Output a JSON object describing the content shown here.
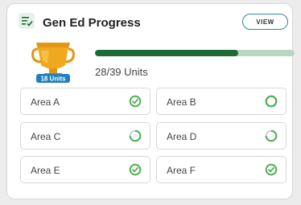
{
  "card": {
    "title": "Gen Ed Progress",
    "view_label": "VIEW",
    "badge_label": "18 Units",
    "units_text": "28/39 Units",
    "progress": {
      "completed": 28,
      "total": 39
    }
  },
  "areas": [
    {
      "label": "Area A",
      "status": "complete"
    },
    {
      "label": "Area B",
      "status": "not-started"
    },
    {
      "label": "Area C",
      "status": "in-progress"
    },
    {
      "label": "Area D",
      "status": "in-progress"
    },
    {
      "label": "Area E",
      "status": "complete"
    },
    {
      "label": "Area F",
      "status": "complete"
    }
  ],
  "colors": {
    "accent_green": "#1d6a37",
    "status_green": "#4caf50",
    "track": "#b9d6c4",
    "button_border": "#2b8a9e",
    "trophy_gold": "#f0a81e",
    "badge_blue": "#1f7fc0"
  },
  "icons": {
    "header": "checklist-icon",
    "trophy": "trophy-icon",
    "complete": "check-circle-icon",
    "in_progress": "partial-circle-icon",
    "not_started": "open-circle-icon"
  }
}
